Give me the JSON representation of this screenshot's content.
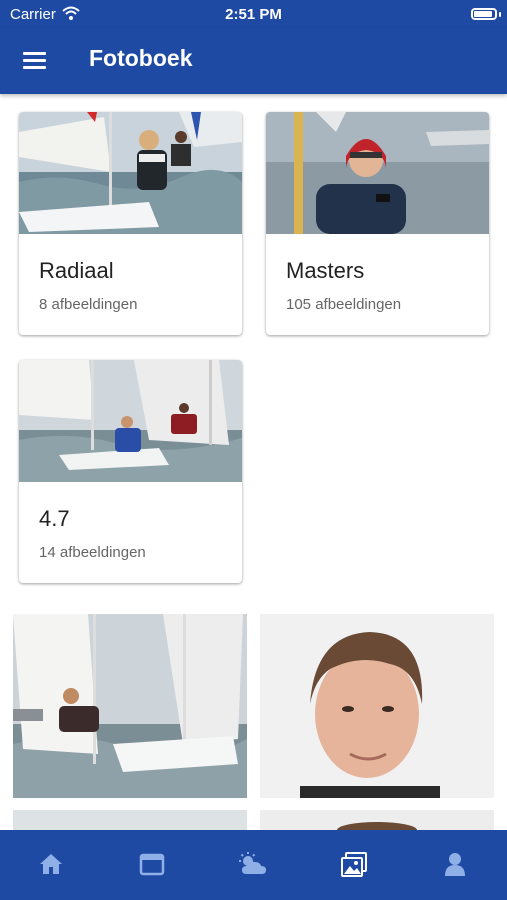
{
  "status_bar": {
    "carrier": "Carrier",
    "time": "2:51 PM"
  },
  "app_bar": {
    "title": "Fotoboek"
  },
  "albums": [
    {
      "name": "Radiaal",
      "count": "8 afbeeldingen"
    },
    {
      "name": "Masters",
      "count": "105 afbeeldingen"
    },
    {
      "name": "4.7",
      "count": "14 afbeeldingen"
    }
  ],
  "tab_bar": {
    "tabs": [
      {
        "icon": "home-icon",
        "active": false
      },
      {
        "icon": "calendar-icon",
        "active": false
      },
      {
        "icon": "weather-icon",
        "active": false
      },
      {
        "icon": "photos-icon",
        "active": true
      },
      {
        "icon": "profile-icon",
        "active": false
      }
    ]
  },
  "colors": {
    "primary": "#1f4aa3",
    "tab_icon": "#8fb0e6",
    "tab_icon_active": "#ffffff"
  }
}
